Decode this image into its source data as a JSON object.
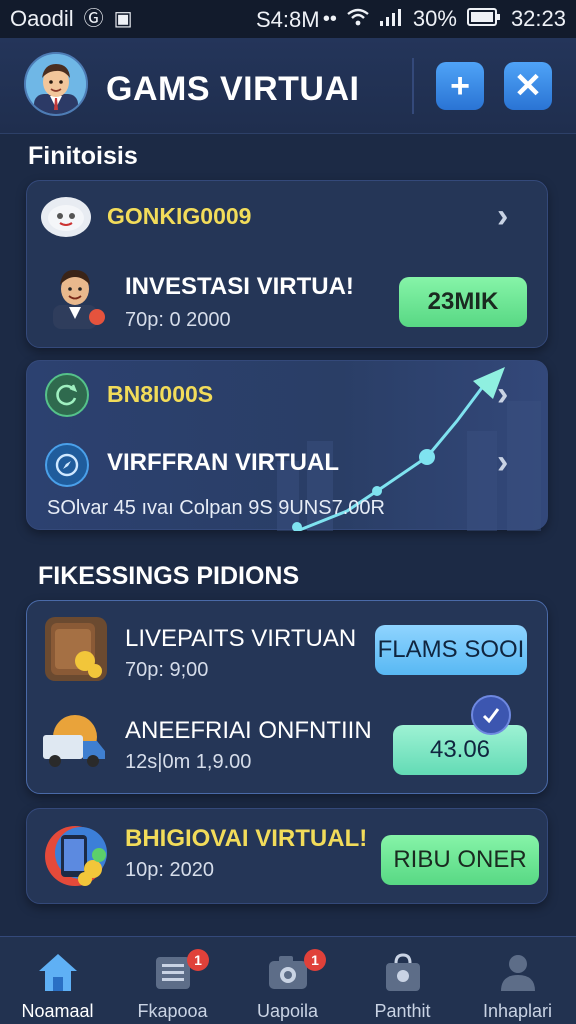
{
  "status_bar": {
    "carrier": "Oaodil",
    "time": "S4:8M",
    "battery": "30%",
    "clock_right": "32:23"
  },
  "header": {
    "title": "GAMS VIRTUAI",
    "add_icon": "add-icon",
    "close_icon": "close-icon"
  },
  "sections": {
    "first_title": "Finitoisis",
    "second_title": "FIKESSINGS PIDIONS"
  },
  "card1": {
    "label": "GONKIG0009",
    "title": "INVESTASI VIRTUA!",
    "sub": "70p: 0 2000",
    "button": "23MIK"
  },
  "card2": {
    "label": "BN8I000S",
    "title": "VIRFFRAN VIRTUAL",
    "sub": "SOlvar 45 ıvaı Colpan 9S 9UNS7.00R"
  },
  "card3": {
    "row1": {
      "title": "LIVEPAITS VIRTUAN",
      "sub": "70p: 9;00",
      "button": "FLAMS SOOI"
    },
    "row2": {
      "title": "ANEEFRIAI ONFNTIIN",
      "sub": "12s|0m 1,9.00",
      "button": "43.06"
    }
  },
  "card4": {
    "title": "BHIGIOVAI VIRTUAL!",
    "sub": "10p: 2020",
    "button": "RIBU ONER"
  },
  "bottom_nav": [
    {
      "label": "Noamaal",
      "icon": "home-icon",
      "badge": ""
    },
    {
      "label": "Fkapooa",
      "icon": "list-icon",
      "badge": "1"
    },
    {
      "label": "Uapoila",
      "icon": "camera-icon",
      "badge": "1"
    },
    {
      "label": "Panthit",
      "icon": "bag-icon",
      "badge": ""
    },
    {
      "label": "Inhaplari",
      "icon": "profile-icon",
      "badge": ""
    }
  ],
  "colors": {
    "background": "#1c2a45",
    "card": "#253657",
    "accent_yellow": "#f2dc5a",
    "accent_green": "#58d884",
    "accent_blue": "#4fa3f7",
    "badge_red": "#e0413a"
  }
}
